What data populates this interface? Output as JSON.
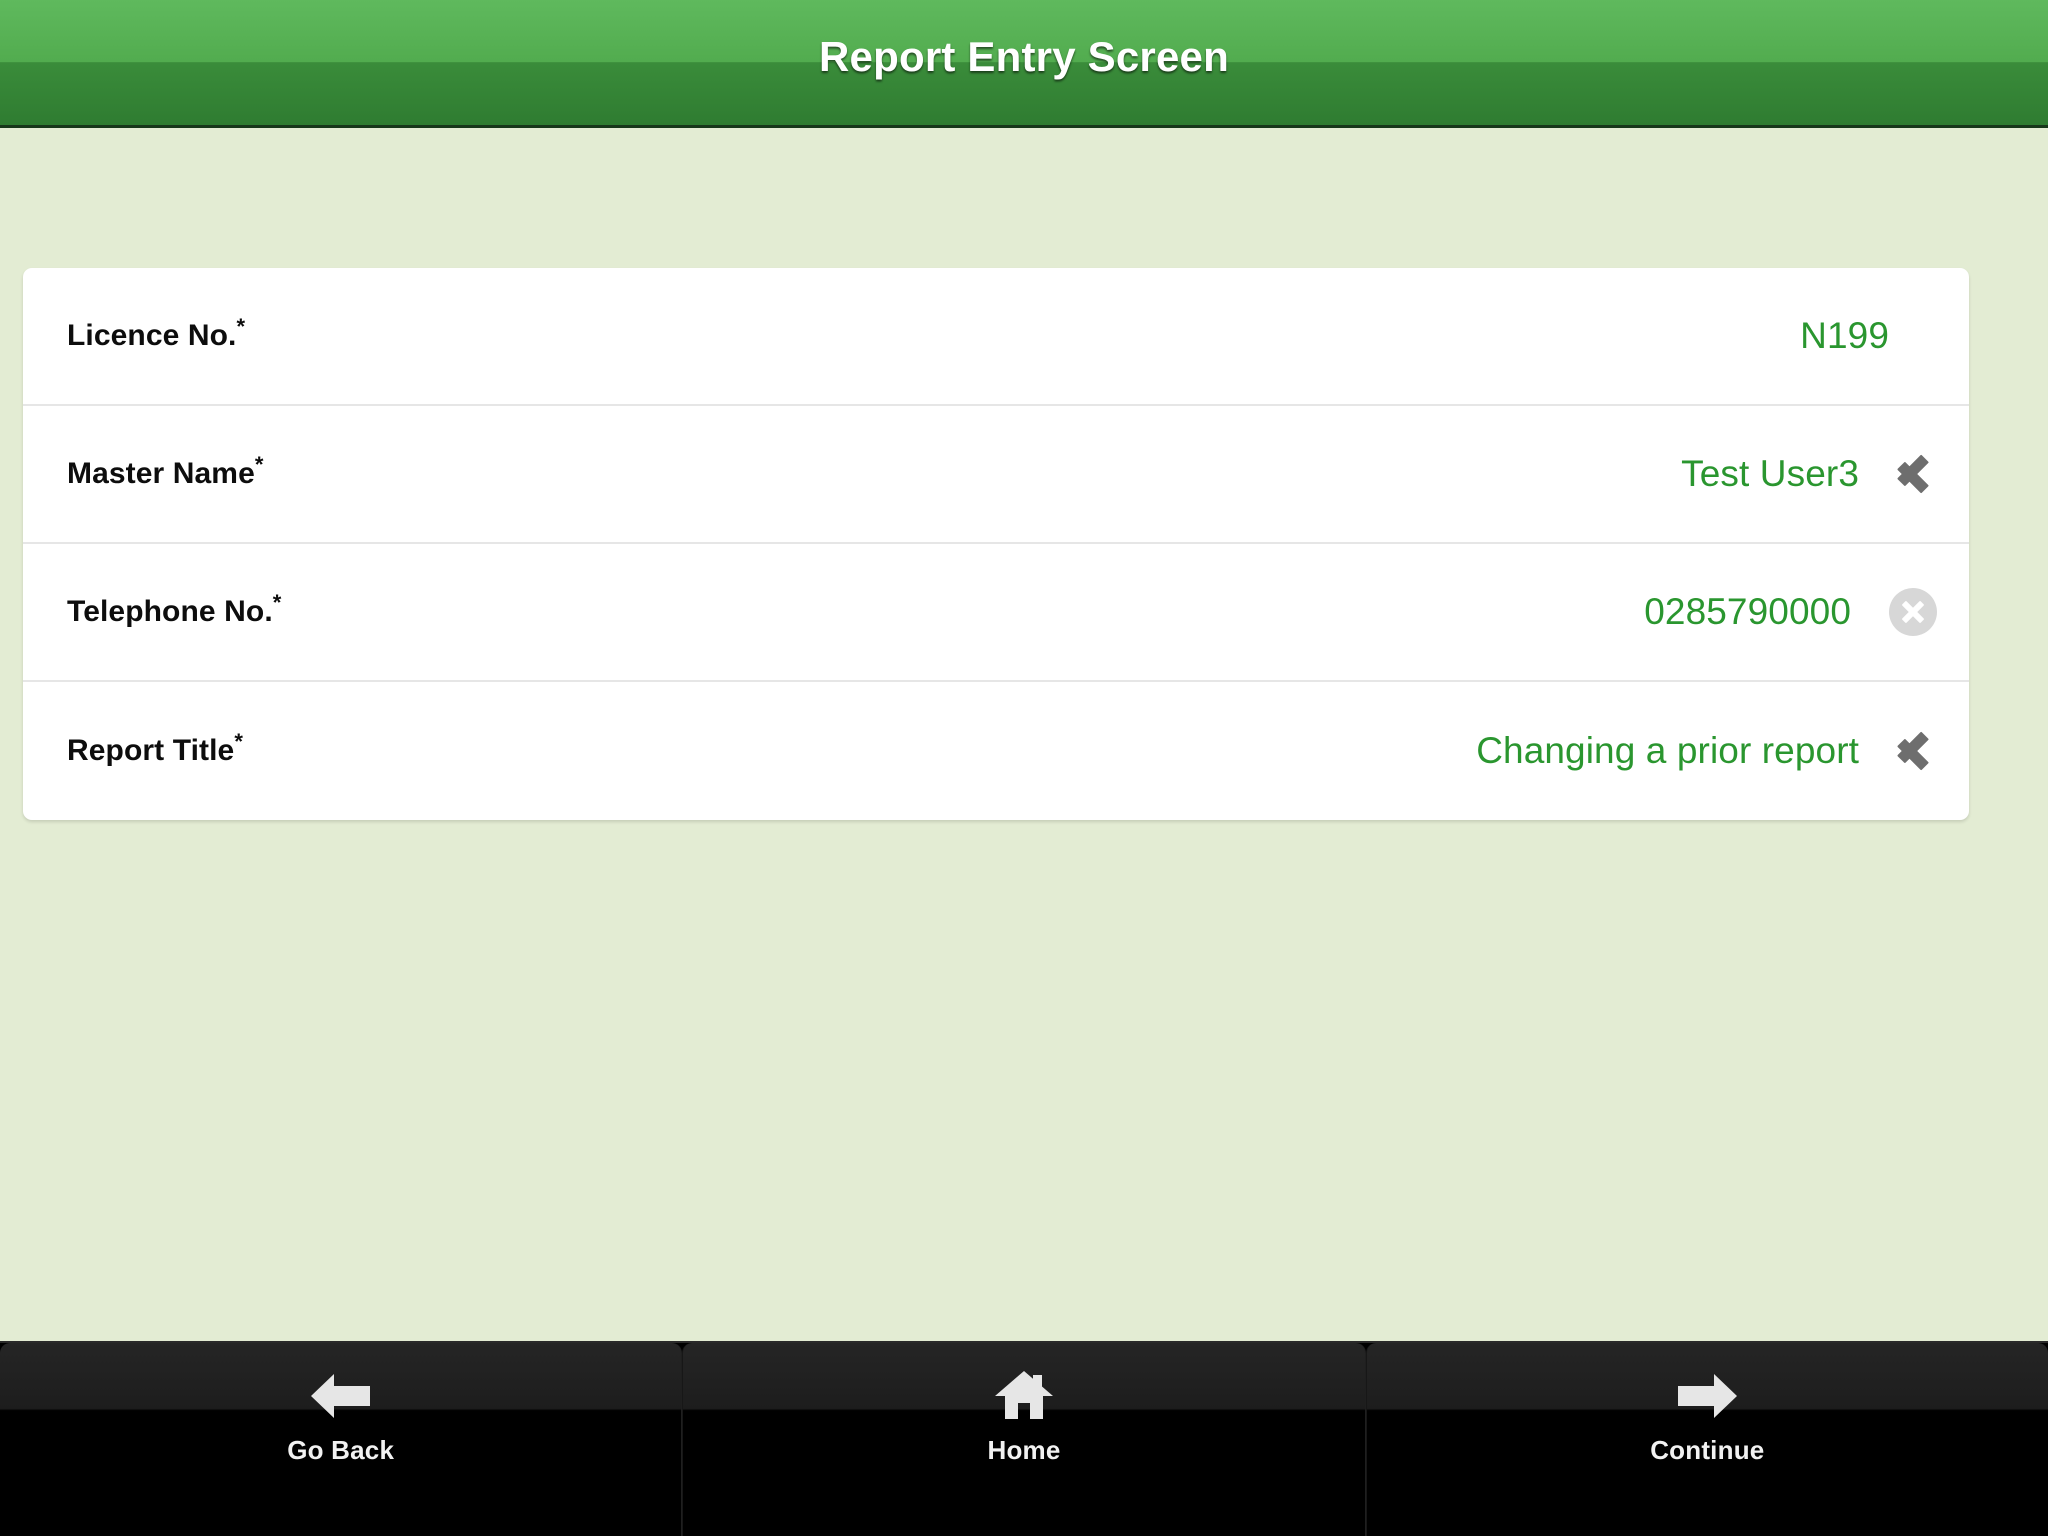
{
  "header": {
    "title": "Report Entry Screen",
    "background_top": "#5fb95d",
    "background_bottom": "#2f7c31"
  },
  "page": {
    "background": "#e3ecd3",
    "value_color": "#2a962f"
  },
  "form": {
    "rows": [
      {
        "label": "Licence No.",
        "required_marker": "*",
        "value": "N199",
        "accessory": "none"
      },
      {
        "label": "Master Name",
        "required_marker": "*",
        "value": "Test User3",
        "accessory": "chevron-right-icon"
      },
      {
        "label": "Telephone No.",
        "required_marker": "*",
        "value": "0285790000",
        "accessory": "clear-icon"
      },
      {
        "label": "Report Title",
        "required_marker": "*",
        "value": "Changing a prior report",
        "accessory": "chevron-right-icon"
      }
    ]
  },
  "navbar": {
    "buttons": [
      {
        "label": "Go Back",
        "icon": "arrow-left-icon"
      },
      {
        "label": "Home",
        "icon": "home-icon"
      },
      {
        "label": "Continue",
        "icon": "arrow-right-icon"
      }
    ]
  }
}
